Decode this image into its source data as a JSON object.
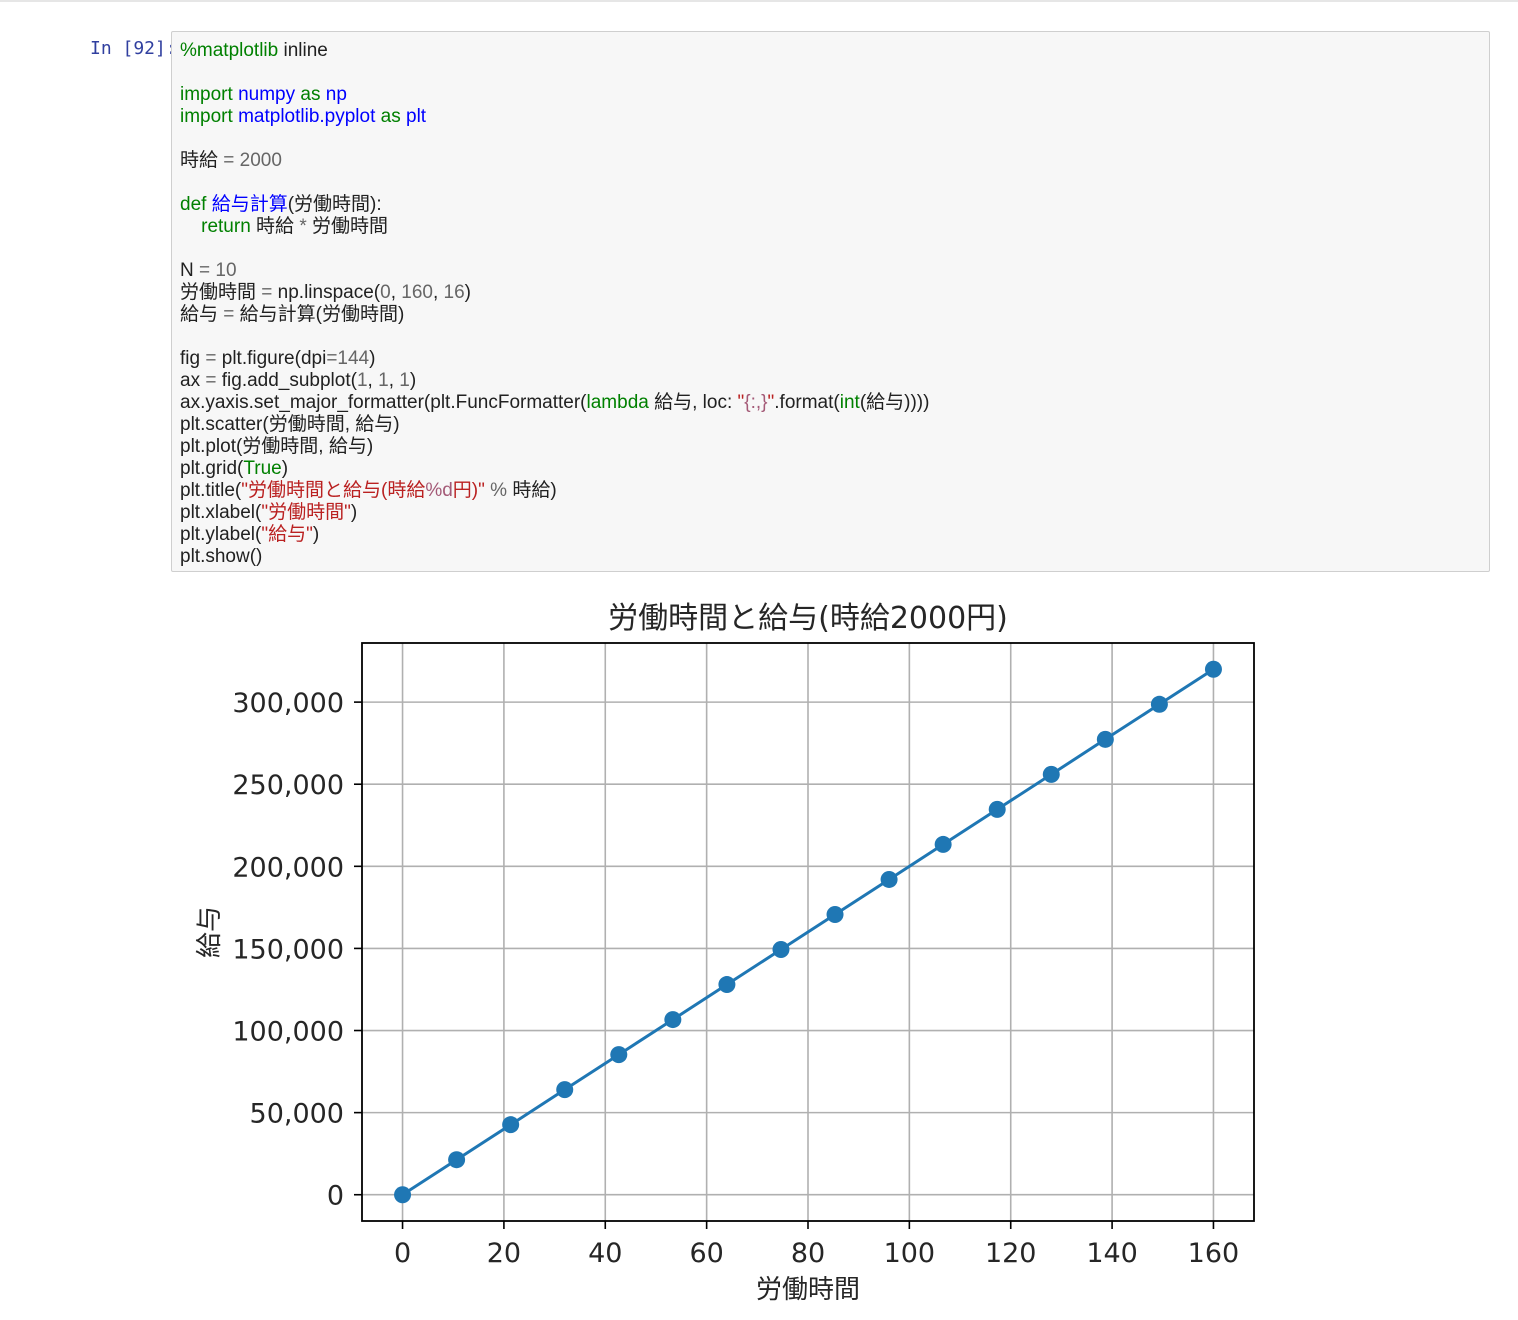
{
  "cell": {
    "prompt": "In [92]:",
    "code_lines": [
      [
        [
          "kw",
          "%matplotlib"
        ],
        [
          "txt",
          " inline"
        ]
      ],
      [],
      [
        [
          "kw",
          "import"
        ],
        [
          "txt",
          " "
        ],
        [
          "nm",
          "numpy"
        ],
        [
          "txt",
          " "
        ],
        [
          "kw",
          "as"
        ],
        [
          "txt",
          " "
        ],
        [
          "nm",
          "np"
        ]
      ],
      [
        [
          "kw",
          "import"
        ],
        [
          "txt",
          " "
        ],
        [
          "nm",
          "matplotlib.pyplot"
        ],
        [
          "txt",
          " "
        ],
        [
          "kw",
          "as"
        ],
        [
          "txt",
          " "
        ],
        [
          "nm",
          "plt"
        ]
      ],
      [],
      [
        [
          "txt",
          "時給 "
        ],
        [
          "op",
          "="
        ],
        [
          "txt",
          " "
        ],
        [
          "num",
          "2000"
        ]
      ],
      [],
      [
        [
          "kw",
          "def"
        ],
        [
          "txt",
          " "
        ],
        [
          "nm",
          "給与計算"
        ],
        [
          "txt",
          "(労働時間):"
        ]
      ],
      [
        [
          "txt",
          "    "
        ],
        [
          "kw",
          "return"
        ],
        [
          "txt",
          " 時給 "
        ],
        [
          "op",
          "*"
        ],
        [
          "txt",
          " 労働時間"
        ]
      ],
      [],
      [
        [
          "txt",
          "N "
        ],
        [
          "op",
          "="
        ],
        [
          "txt",
          " "
        ],
        [
          "num",
          "10"
        ]
      ],
      [
        [
          "txt",
          "労働時間 "
        ],
        [
          "op",
          "="
        ],
        [
          "txt",
          " np.linspace("
        ],
        [
          "num",
          "0"
        ],
        [
          "txt",
          ", "
        ],
        [
          "num",
          "160"
        ],
        [
          "txt",
          ", "
        ],
        [
          "num",
          "16"
        ],
        [
          "txt",
          ")"
        ]
      ],
      [
        [
          "txt",
          "給与 "
        ],
        [
          "op",
          "="
        ],
        [
          "txt",
          " 給与計算(労働時間)"
        ]
      ],
      [],
      [
        [
          "txt",
          "fig "
        ],
        [
          "op",
          "="
        ],
        [
          "txt",
          " plt.figure(dpi"
        ],
        [
          "op",
          "="
        ],
        [
          "num",
          "144"
        ],
        [
          "txt",
          ")"
        ]
      ],
      [
        [
          "txt",
          "ax "
        ],
        [
          "op",
          "="
        ],
        [
          "txt",
          " fig.add_subplot("
        ],
        [
          "num",
          "1"
        ],
        [
          "txt",
          ", "
        ],
        [
          "num",
          "1"
        ],
        [
          "txt",
          ", "
        ],
        [
          "num",
          "1"
        ],
        [
          "txt",
          ")"
        ]
      ],
      [
        [
          "txt",
          "ax.yaxis.set_major_formatter(plt.FuncFormatter("
        ],
        [
          "kw",
          "lambda"
        ],
        [
          "txt",
          " 給与, loc: "
        ],
        [
          "str",
          "\""
        ],
        [
          "int",
          "{:,}"
        ],
        [
          "str",
          "\""
        ],
        [
          "txt",
          ".format("
        ],
        [
          "bi",
          "int"
        ],
        [
          "txt",
          "(給与))))"
        ]
      ],
      [
        [
          "txt",
          "plt.scatter(労働時間, 給与)"
        ]
      ],
      [
        [
          "txt",
          "plt.plot(労働時間, 給与)"
        ]
      ],
      [
        [
          "txt",
          "plt.grid("
        ],
        [
          "kw",
          "True"
        ],
        [
          "txt",
          ")"
        ]
      ],
      [
        [
          "txt",
          "plt.title("
        ],
        [
          "str",
          "\"労働時間と給与(時給"
        ],
        [
          "int",
          "%d"
        ],
        [
          "str",
          "円)\""
        ],
        [
          "txt",
          " "
        ],
        [
          "op",
          "%"
        ],
        [
          "txt",
          " 時給)"
        ]
      ],
      [
        [
          "txt",
          "plt.xlabel("
        ],
        [
          "str",
          "\"労働時間\""
        ],
        [
          "txt",
          ")"
        ]
      ],
      [
        [
          "txt",
          "plt.ylabel("
        ],
        [
          "str",
          "\"給与\""
        ],
        [
          "txt",
          ")"
        ]
      ],
      [
        [
          "txt",
          "plt.show()"
        ]
      ]
    ]
  },
  "chart_data": {
    "type": "line",
    "title": "労働時間と給与(時給2000円)",
    "xlabel": "労働時間",
    "ylabel": "給与",
    "x": [
      0,
      10.6667,
      21.3333,
      32,
      42.6667,
      53.3333,
      64,
      74.6667,
      85.3333,
      96,
      106.6667,
      117.3333,
      128,
      138.6667,
      149.3333,
      160
    ],
    "series": [
      {
        "values": [
          0,
          21333,
          42667,
          64000,
          85333,
          106667,
          128000,
          149333,
          170667,
          192000,
          213333,
          234667,
          256000,
          277333,
          298667,
          320000
        ],
        "markers": true
      }
    ],
    "xticks": [
      "0",
      "20",
      "40",
      "60",
      "80",
      "100",
      "120",
      "140",
      "160"
    ],
    "yticks": [
      "0",
      "50,000",
      "100,000",
      "150,000",
      "200,000",
      "250,000",
      "300,000"
    ],
    "xlim": [
      -8,
      168
    ],
    "ylim": [
      -16000,
      336000
    ],
    "grid": true,
    "color": "#1f77b4"
  }
}
